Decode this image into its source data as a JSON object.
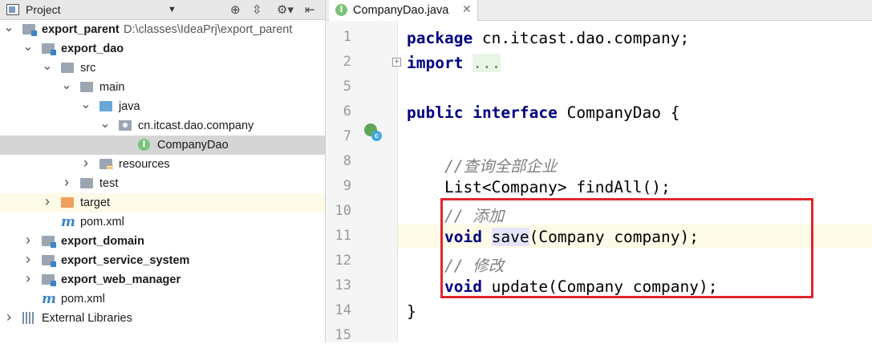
{
  "project_panel": {
    "title": "Project",
    "tree": [
      {
        "label": "export_parent",
        "bold": true,
        "path": "D:\\classes\\IdeaPrj\\export_parent",
        "icon": "module-icon",
        "arrow": "expanded"
      },
      {
        "label": "export_dao",
        "bold": true,
        "icon": "module-icon",
        "arrow": "expanded"
      },
      {
        "label": "src",
        "icon": "folder-icon",
        "arrow": "expanded"
      },
      {
        "label": "main",
        "icon": "folder-icon",
        "arrow": "expanded"
      },
      {
        "label": "java",
        "icon": "source-folder-icon",
        "arrow": "expanded"
      },
      {
        "label": "cn.itcast.dao.company",
        "icon": "package-icon",
        "arrow": "expanded"
      },
      {
        "label": "CompanyDao",
        "icon": "interface-icon",
        "arrow": "none",
        "selected": true
      },
      {
        "label": "resources",
        "icon": "resources-folder-icon",
        "arrow": "collapsed"
      },
      {
        "label": "test",
        "icon": "folder-icon",
        "arrow": "collapsed"
      },
      {
        "label": "target",
        "icon": "excluded-folder-icon",
        "arrow": "collapsed"
      },
      {
        "label": "pom.xml",
        "icon": "maven-icon",
        "arrow": "none"
      },
      {
        "label": "export_domain",
        "bold": true,
        "icon": "module-icon",
        "arrow": "collapsed"
      },
      {
        "label": "export_service_system",
        "bold": true,
        "icon": "module-icon",
        "arrow": "collapsed"
      },
      {
        "label": "export_web_manager",
        "bold": true,
        "icon": "module-icon",
        "arrow": "collapsed"
      },
      {
        "label": "pom.xml",
        "icon": "maven-icon",
        "arrow": "none"
      },
      {
        "label": "External Libraries",
        "icon": "library-icon",
        "arrow": "collapsed"
      }
    ]
  },
  "editor": {
    "tab": {
      "label": "CompanyDao.java",
      "icon": "interface-icon"
    },
    "lines": [
      {
        "num": "1",
        "tokens": [
          {
            "t": "package",
            "c": "kw"
          },
          {
            "t": " cn.itcast.dao.company;"
          }
        ]
      },
      {
        "num": "2",
        "tokens": [
          {
            "t": "import",
            "c": "kw"
          },
          {
            "t": " "
          },
          {
            "t": "...",
            "c": "fold-box"
          }
        ]
      },
      {
        "num": "5",
        "tokens": []
      },
      {
        "num": "6",
        "tokens": [
          {
            "t": "public",
            "c": "kw"
          },
          {
            "t": " "
          },
          {
            "t": "interface",
            "c": "kw"
          },
          {
            "t": " CompanyDao {"
          }
        ]
      },
      {
        "num": "7",
        "tokens": []
      },
      {
        "num": "8",
        "tokens": [
          {
            "t": "    "
          },
          {
            "t": "//查询全部企业",
            "c": "cm"
          }
        ]
      },
      {
        "num": "9",
        "tokens": [
          {
            "t": "    List<Company> findAll();"
          }
        ]
      },
      {
        "num": "10",
        "tokens": [
          {
            "t": "    "
          },
          {
            "t": "// 添加",
            "c": "cm"
          }
        ]
      },
      {
        "num": "11",
        "tokens": [
          {
            "t": "    "
          },
          {
            "t": "void",
            "c": "kw"
          },
          {
            "t": " "
          },
          {
            "t": "save",
            "c": "hl"
          },
          {
            "t": "(Company company);"
          }
        ],
        "current": true
      },
      {
        "num": "12",
        "tokens": [
          {
            "t": "    "
          },
          {
            "t": "// 修改",
            "c": "cm"
          }
        ]
      },
      {
        "num": "13",
        "tokens": [
          {
            "t": "    "
          },
          {
            "t": "void",
            "c": "kw"
          },
          {
            "t": " update(Company company);"
          }
        ]
      },
      {
        "num": "14",
        "tokens": [
          {
            "t": "}"
          }
        ]
      },
      {
        "num": "15",
        "tokens": []
      }
    ]
  }
}
